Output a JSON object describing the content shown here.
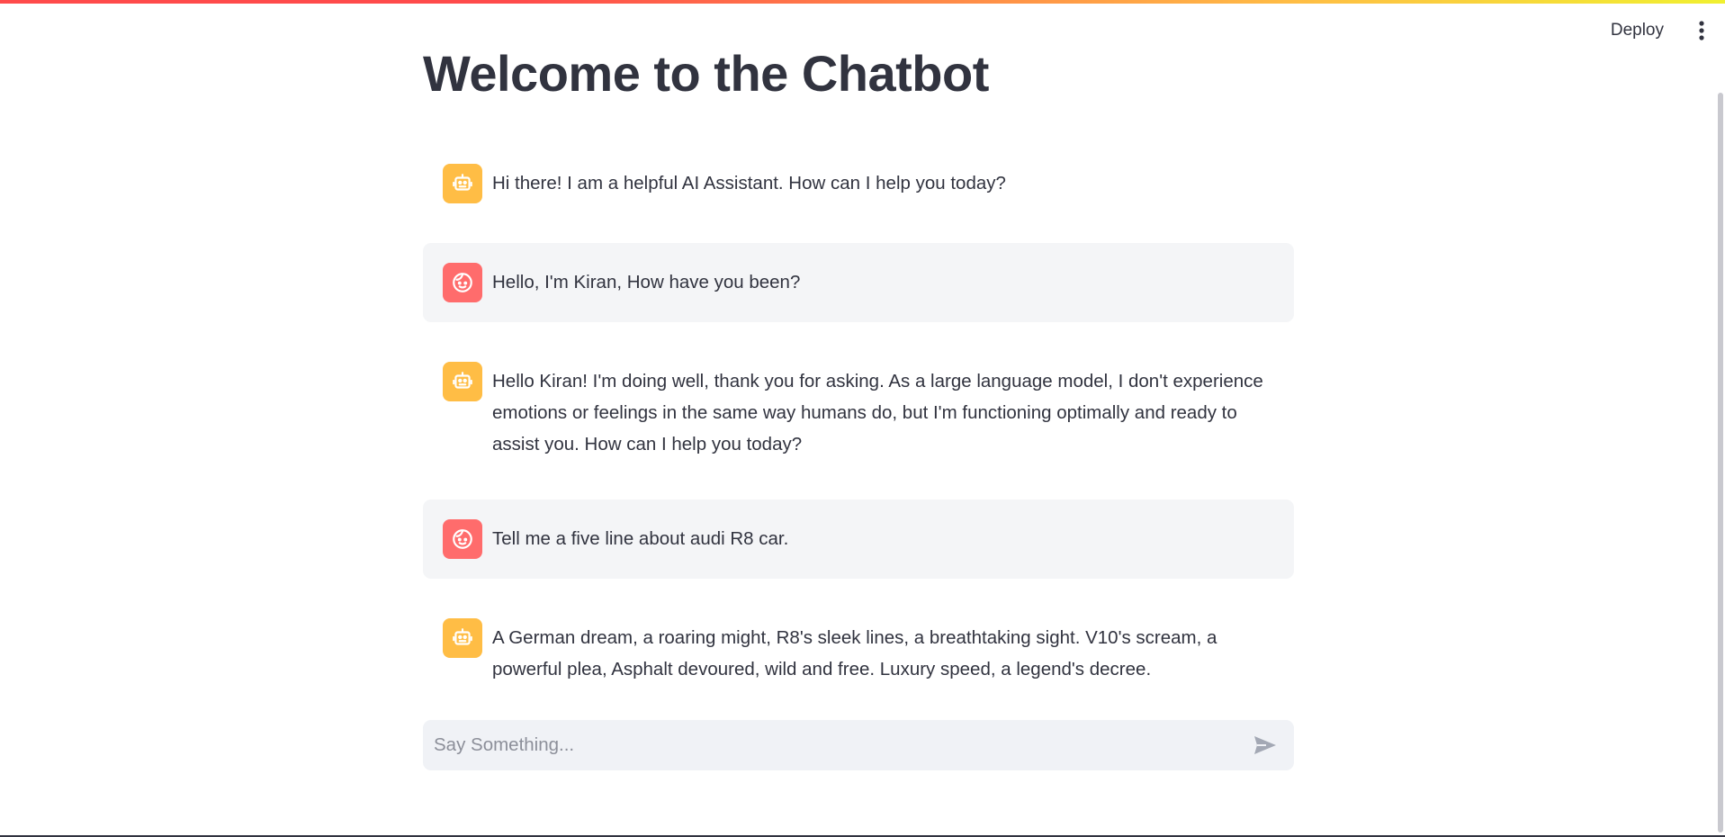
{
  "header": {
    "deploy_label": "Deploy",
    "menu_icon": "vertical-ellipsis-icon"
  },
  "main": {
    "title": "Welcome to the Chatbot"
  },
  "messages": [
    {
      "role": "assistant",
      "avatar_icon": "robot-icon",
      "text": "Hi there! I am a helpful AI Assistant. How can I help you today?"
    },
    {
      "role": "user",
      "avatar_icon": "smiley-face-icon",
      "text": "Hello, I'm Kiran, How have you been?"
    },
    {
      "role": "assistant",
      "avatar_icon": "robot-icon",
      "text": "Hello Kiran! I'm doing well, thank you for asking. As a large language model, I don't experience emotions or feelings in the same way humans do, but I'm functioning optimally and ready to assist you. How can I help you today?"
    },
    {
      "role": "user",
      "avatar_icon": "smiley-face-icon",
      "text": "Tell me a five line about audi R8 car."
    },
    {
      "role": "assistant",
      "avatar_icon": "robot-icon",
      "text": "A German dream, a roaring might, R8's sleek lines, a breathtaking sight. V10's scream, a powerful plea, Asphalt devoured, wild and free. Luxury speed, a legend's decree."
    }
  ],
  "chat_input": {
    "value": "",
    "placeholder": "Say Something...",
    "send_icon": "send-arrow-icon"
  },
  "colors": {
    "assistant_avatar": "#ffbd45",
    "user_avatar": "#ff6c6c",
    "user_message_bg": "#f4f5f7",
    "text": "#31333f",
    "input_bg": "#f0f2f6"
  }
}
